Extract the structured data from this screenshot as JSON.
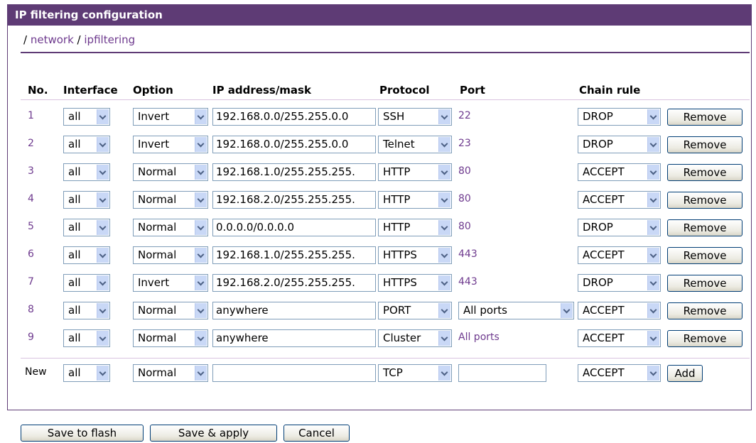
{
  "title": "IP filtering configuration",
  "breadcrumb": {
    "sep": "/",
    "items": [
      "network",
      "ipfiltering"
    ]
  },
  "headers": {
    "no": "No.",
    "interface": "Interface",
    "option": "Option",
    "ip": "IP address/mask",
    "protocol": "Protocol",
    "port": "Port",
    "chain": "Chain rule"
  },
  "rows": [
    {
      "no": "1",
      "interface": "all",
      "option": "Invert",
      "ip": "192.168.0.0/255.255.0.0",
      "protocol": "SSH",
      "port": "22",
      "chain": "DROP",
      "action": "Remove"
    },
    {
      "no": "2",
      "interface": "all",
      "option": "Invert",
      "ip": "192.168.0.0/255.255.0.0",
      "protocol": "Telnet",
      "port": "23",
      "chain": "DROP",
      "action": "Remove"
    },
    {
      "no": "3",
      "interface": "all",
      "option": "Normal",
      "ip": "192.168.1.0/255.255.255.",
      "protocol": "HTTP",
      "port": "80",
      "chain": "ACCEPT",
      "action": "Remove"
    },
    {
      "no": "4",
      "interface": "all",
      "option": "Normal",
      "ip": "192.168.2.0/255.255.255.",
      "protocol": "HTTP",
      "port": "80",
      "chain": "ACCEPT",
      "action": "Remove"
    },
    {
      "no": "5",
      "interface": "all",
      "option": "Normal",
      "ip": "0.0.0.0/0.0.0.0",
      "protocol": "HTTP",
      "port": "80",
      "chain": "DROP",
      "action": "Remove"
    },
    {
      "no": "6",
      "interface": "all",
      "option": "Normal",
      "ip": "192.168.1.0/255.255.255.",
      "protocol": "HTTPS",
      "port": "443",
      "chain": "ACCEPT",
      "action": "Remove"
    },
    {
      "no": "7",
      "interface": "all",
      "option": "Invert",
      "ip": "192.168.2.0/255.255.255.",
      "protocol": "HTTPS",
      "port": "443",
      "chain": "DROP",
      "action": "Remove"
    },
    {
      "no": "8",
      "interface": "all",
      "option": "Normal",
      "ip": "anywhere",
      "protocol": "PORT",
      "port_select": "All ports",
      "chain": "ACCEPT",
      "action": "Remove"
    },
    {
      "no": "9",
      "interface": "all",
      "option": "Normal",
      "ip": "anywhere",
      "protocol": "Cluster",
      "port": "All ports",
      "chain": "ACCEPT",
      "action": "Remove"
    }
  ],
  "new_row": {
    "no": "New",
    "interface": "all",
    "option": "Normal",
    "ip": "",
    "protocol": "TCP",
    "port": "",
    "chain": "ACCEPT",
    "action": "Add"
  },
  "footer": {
    "save_flash": "Save to flash",
    "save_apply": "Save & apply",
    "cancel": "Cancel"
  },
  "colors": {
    "header_bg": "#5e3b75",
    "link": "#6e3a8e",
    "input_border": "#7f9db9"
  }
}
